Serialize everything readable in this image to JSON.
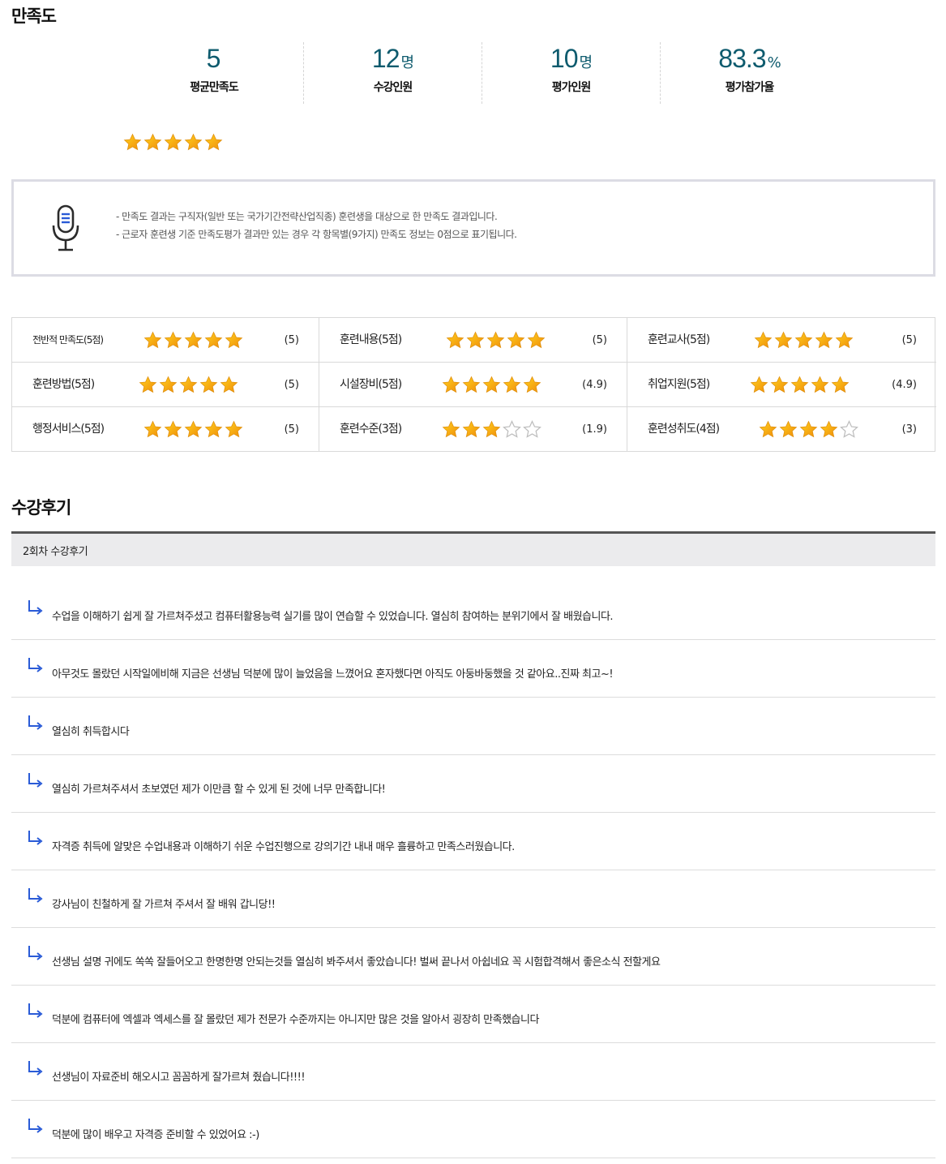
{
  "satisfaction": {
    "title": "만족도",
    "stats": [
      {
        "value": "5",
        "unit": "",
        "label": "평균만족도"
      },
      {
        "value": "12",
        "unit": "명",
        "label": "수강인원"
      },
      {
        "value": "10",
        "unit": "명",
        "label": "평가인원"
      },
      {
        "value": "83.3",
        "unit": "%",
        "label": "평가참가율"
      }
    ],
    "average_stars": 5,
    "notice": {
      "icon": "microphone-icon",
      "lines": [
        "- 만족도 결과는 구직자(일반 또는 국가기간전략산업직종) 훈련생을 대상으로 한 만족도 결과입니다.",
        "- 근로자 훈련생 기준 만족도평가 결과만 있는 경우 각 항목별(9가지) 만족도 정보는 0점으로 표기됩니다."
      ]
    },
    "items": [
      {
        "label": "전반적 만족도(5점)",
        "stars": 5,
        "max": 5,
        "score": "(5)"
      },
      {
        "label": "훈련내용(5점)",
        "stars": 5,
        "max": 5,
        "score": "(5)"
      },
      {
        "label": "훈련교사(5점)",
        "stars": 5,
        "max": 5,
        "score": "(5)"
      },
      {
        "label": "훈련방법(5점)",
        "stars": 5,
        "max": 5,
        "score": "(5)"
      },
      {
        "label": "시설장비(5점)",
        "stars": 5,
        "max": 5,
        "score": "(4.9)"
      },
      {
        "label": "취업지원(5점)",
        "stars": 5,
        "max": 5,
        "score": "(4.9)"
      },
      {
        "label": "행정서비스(5점)",
        "stars": 5,
        "max": 5,
        "score": "(5)"
      },
      {
        "label": "훈련수준(3점)",
        "stars": 3,
        "max": 5,
        "score": "(1.9)"
      },
      {
        "label": "훈련성취도(4점)",
        "stars": 4,
        "max": 5,
        "score": "(3)"
      }
    ]
  },
  "reviews": {
    "title": "수강후기",
    "round_header": "2회차 수강후기",
    "items": [
      "수업을 이해하기 쉽게 잘 가르쳐주셨고 컴퓨터활용능력 실기를 많이 연습할 수 있었습니다. 열심히 참여하는 분위기에서 잘 배웠습니다.",
      "아무것도 몰랐던 시작일에비해 지금은 선생님 덕분에 많이 늘었음을 느꼈어요 혼자했다면 아직도 아둥바둥했을 것 같아요..진짜 최고~!",
      "열심히 취득합시다",
      "열심히 가르쳐주셔서 초보였던 제가 이만큼 할 수 있게 된 것에 너무 만족합니다!",
      "자격증 취득에 알맞은 수업내용과 이해하기 쉬운 수업진행으로 강의기간 내내 매우 흘륭하고 만족스러웠습니다.",
      "강사님이 친철하게 잘 가르쳐 주셔서 잘 배워 갑니당!!",
      "선생님 설명 귀에도 쏙쏙 잘들어오고 한명한명 안되는것들 열심히 봐주셔서 좋았습니다! 벌써 끝나서 아쉽네요 꼭 시험합격해서 좋은소식 전할게요",
      "덕분에 컴퓨터에 엑셀과 엑세스를 잘 몰랐던 제가 전문가 수준까지는 아니지만 많은 것을 알아서 굉장히 만족했습니다",
      "선생님이 자료준비 해오시고 꼼꼼하게 잘가르쳐 줬습니다!!!!",
      "덕분에 많이 배우고 자격증 준비할 수 있었어요 :-)"
    ]
  },
  "colors": {
    "accent": "#0e5b6e",
    "star_fill_top": "#ffd21e",
    "star_fill_bottom": "#f08c0a",
    "star_empty": "#bdbdbd",
    "arrow": "#2a5bd7"
  }
}
